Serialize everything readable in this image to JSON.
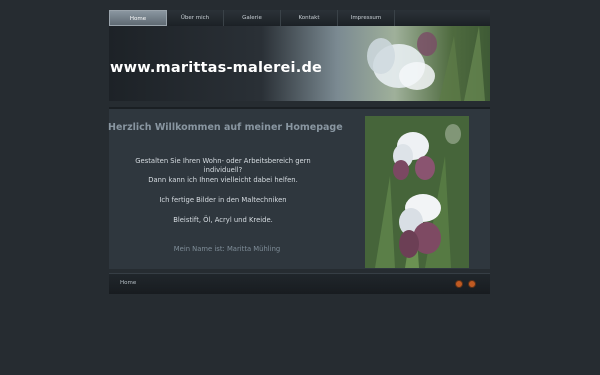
{
  "nav": {
    "items": [
      {
        "label": "Home",
        "active": true
      },
      {
        "label": "Über mich",
        "active": false
      },
      {
        "label": "Galerie",
        "active": false
      },
      {
        "label": "Kontakt",
        "active": false
      },
      {
        "label": "Impressum",
        "active": false
      }
    ]
  },
  "banner": {
    "url_text": "www.marittas-malerei.de"
  },
  "main": {
    "heading": "Herzlich Willkommen auf meiner Homepage",
    "paragraph1_line1": "Gestalten Sie Ihren Wohn- oder Arbeitsbereich gern",
    "paragraph1_line2": "individuell?",
    "paragraph1_line3": "Dann kann ich Ihnen vielleicht dabei helfen.",
    "paragraph2": "Ich fertige Bilder in den Maltechniken",
    "paragraph3": "Bleistift, Öl, Acryl und Kreide.",
    "name_line": "Mein Name ist:  Maritta Mühling"
  },
  "footer": {
    "breadcrumb": "Home",
    "prev_icon": "chevron-left-icon",
    "next_icon": "chevron-right-icon"
  },
  "colors": {
    "background": "#262c31",
    "accent": "#c05a22",
    "heading": "#8996a1"
  }
}
